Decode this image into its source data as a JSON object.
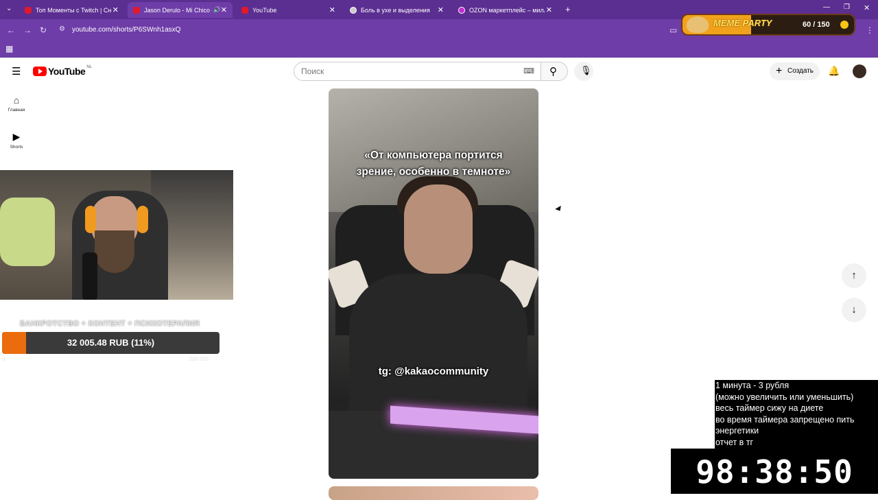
{
  "browser": {
    "tabs": [
      {
        "title": "Топ Моменты с Twitch | Сново",
        "active": false
      },
      {
        "title": "Jason Derulo - Mi Chico #d",
        "active": true
      },
      {
        "title": "YouTube",
        "active": false
      },
      {
        "title": "Боль в ухе и выделения",
        "active": false
      },
      {
        "title": "OZON маркетплейс – миллио",
        "active": false
      }
    ],
    "new_tab": "+",
    "url": "youtube.com/shorts/P6SWnh1asxQ"
  },
  "youtube": {
    "logo_text": "YouTube",
    "country": "NL",
    "search_placeholder": "Поиск",
    "create_label": "Создать",
    "guide": [
      {
        "label": "Главная",
        "icon": "home-icon"
      },
      {
        "label": "Shorts",
        "icon": "shorts-icon"
      }
    ]
  },
  "short": {
    "caption_line1": "«От компьютера портится",
    "caption_line2": "зрение, особенно в темноте»",
    "watermark": "tg: @kakaocommunity"
  },
  "overlay": {
    "goal_title": "БАНКРОТСТВО + КОНТЕНТ + ПСИХОТЕРАПИЯ",
    "goal_text": "32 005.48 RUB (11%)",
    "goal_progress": 0.11,
    "goal_min": "0",
    "goal_max": "300 000",
    "timer_lines": [
      "1 минута - 3 рубля",
      "(можно увеличить или уменьшить)",
      "весь таймер сижу на диете",
      "во время таймера запрещено пить",
      "энергетики",
      "отчет в тг"
    ],
    "timer": "98:38:50",
    "meme_title": "MEME PARTY",
    "meme_count": "60 / 150",
    "meme_progress": 0.4
  }
}
